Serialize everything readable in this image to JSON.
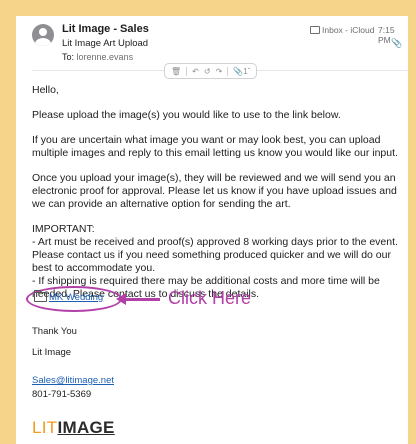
{
  "header": {
    "sender": "Lit Image - Sales",
    "subject": "Lit Image Art Upload",
    "to_label": "To:",
    "to": "lorenne.evans",
    "mailbox": "Inbox - iCloud",
    "time": "7:15 PM",
    "toolbar": {
      "trash_icon": "trash-icon",
      "reply_icon": "reply-icon",
      "reply_all_icon": "reply-all-icon",
      "forward_icon": "forward-icon",
      "attachment_count": "1"
    }
  },
  "body": {
    "greeting": "Hello,",
    "p1": "Please upload the image(s) you would like to use to the link below.",
    "p2": "If you are uncertain what image you want or may look best, you can upload multiple images and reply to this email letting us know you would like our input.",
    "p3": "Once you upload your image(s), they will be reviewed and we will send you an electronic proof for approval. Please let us know if you have upload issues and we can provide an alternative option for sending the art.",
    "important_title": "IMPORTANT:",
    "important_1": "- Art must be received and proof(s) approved 8 working days prior to the event. Please contact us if you need something produced quicker and we will do our best to accommodate you.",
    "important_2": "- If shipping is required there may be additional costs and more time will be needed. Please contact us to discuss the details."
  },
  "link": {
    "label": "MK Wedding",
    "annotation": "Click Here",
    "annotation_color": "#b33fa8"
  },
  "signature": {
    "thanks": "Thank You",
    "company": "Lit Image",
    "email": "Sales@litimage.net",
    "phone": "801-791-5369",
    "logo_lit": "LIT",
    "logo_image": "IMAGE"
  },
  "colors": {
    "background": "#f6d58a",
    "link": "#1a5fb4",
    "logo_orange": "#f19a1b"
  }
}
